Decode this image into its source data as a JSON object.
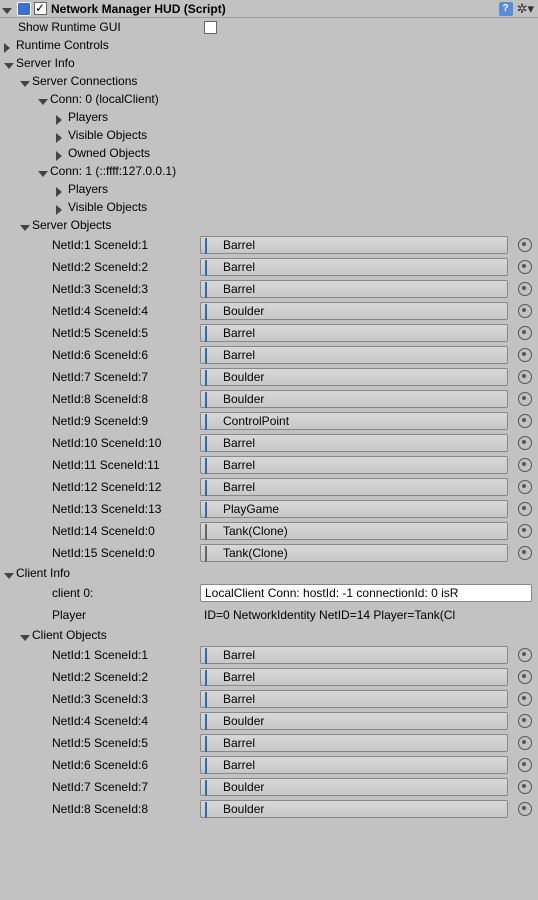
{
  "header": {
    "title": "Network Manager HUD (Script)",
    "enabled": true
  },
  "showRuntimeGUI": {
    "label": "Show Runtime GUI",
    "checked": false
  },
  "sections": {
    "runtimeControls": "Runtime Controls",
    "serverInfo": "Server Info",
    "serverConnections": "Server Connections",
    "serverObjects": "Server Objects",
    "clientInfo": "Client Info",
    "clientObjects": "Client Objects"
  },
  "connections": [
    {
      "label": "Conn: 0 (localClient)",
      "children": [
        "Players",
        "Visible Objects",
        "Owned Objects"
      ]
    },
    {
      "label": "Conn: 1 (::ffff:127.0.0.1)",
      "children": [
        "Players",
        "Visible Objects"
      ]
    }
  ],
  "serverObjects": [
    {
      "label": "NetId:1 SceneId:1",
      "name": "Barrel",
      "iconType": "blue"
    },
    {
      "label": "NetId:2 SceneId:2",
      "name": "Barrel",
      "iconType": "blue"
    },
    {
      "label": "NetId:3 SceneId:3",
      "name": "Barrel",
      "iconType": "blue"
    },
    {
      "label": "NetId:4 SceneId:4",
      "name": "Boulder",
      "iconType": "blue"
    },
    {
      "label": "NetId:5 SceneId:5",
      "name": "Barrel",
      "iconType": "blue"
    },
    {
      "label": "NetId:6 SceneId:6",
      "name": "Barrel",
      "iconType": "blue"
    },
    {
      "label": "NetId:7 SceneId:7",
      "name": "Boulder",
      "iconType": "blue"
    },
    {
      "label": "NetId:8 SceneId:8",
      "name": "Boulder",
      "iconType": "blue"
    },
    {
      "label": "NetId:9 SceneId:9",
      "name": "ControlPoint",
      "iconType": "blue"
    },
    {
      "label": "NetId:10 SceneId:10",
      "name": "Barrel",
      "iconType": "blue"
    },
    {
      "label": "NetId:11 SceneId:11",
      "name": "Barrel",
      "iconType": "blue"
    },
    {
      "label": "NetId:12 SceneId:12",
      "name": "Barrel",
      "iconType": "blue"
    },
    {
      "label": "NetId:13 SceneId:13",
      "name": "PlayGame",
      "iconType": "blue"
    },
    {
      "label": "NetId:14 SceneId:0",
      "name": "Tank(Clone)",
      "iconType": "multi"
    },
    {
      "label": "NetId:15 SceneId:0",
      "name": "Tank(Clone)",
      "iconType": "multi"
    }
  ],
  "clientInfo": {
    "client0Label": "client 0:",
    "client0Value": "LocalClient Conn: hostId: -1 connectionId: 0 isR",
    "playerLabel": "Player",
    "playerValue": "ID=0 NetworkIdentity NetID=14 Player=Tank(Cl"
  },
  "clientObjects": [
    {
      "label": "NetId:1 SceneId:1",
      "name": "Barrel",
      "iconType": "blue"
    },
    {
      "label": "NetId:2 SceneId:2",
      "name": "Barrel",
      "iconType": "blue"
    },
    {
      "label": "NetId:3 SceneId:3",
      "name": "Barrel",
      "iconType": "blue"
    },
    {
      "label": "NetId:4 SceneId:4",
      "name": "Boulder",
      "iconType": "blue"
    },
    {
      "label": "NetId:5 SceneId:5",
      "name": "Barrel",
      "iconType": "blue"
    },
    {
      "label": "NetId:6 SceneId:6",
      "name": "Barrel",
      "iconType": "blue"
    },
    {
      "label": "NetId:7 SceneId:7",
      "name": "Boulder",
      "iconType": "blue"
    },
    {
      "label": "NetId:8 SceneId:8",
      "name": "Boulder",
      "iconType": "blue"
    }
  ]
}
